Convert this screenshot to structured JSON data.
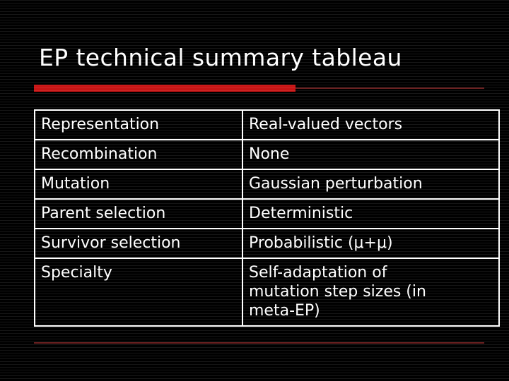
{
  "slide": {
    "title": "EP technical summary tableau",
    "accent_color_thick": "#c81414",
    "accent_color_thin": "#6b2020",
    "text_color": "#ffffff",
    "background_color": "#000000"
  },
  "tableau": {
    "rows": [
      {
        "key": "Representation",
        "value_lines": [
          "Real-valued vectors"
        ]
      },
      {
        "key": "Recombination",
        "value_lines": [
          "None"
        ]
      },
      {
        "key": "Mutation",
        "value_lines": [
          "Gaussian perturbation"
        ]
      },
      {
        "key": "Parent selection",
        "value_lines": [
          "Deterministic"
        ]
      },
      {
        "key": "Survivor selection",
        "value_lines": [
          "Probabilistic (μ+μ)"
        ]
      },
      {
        "key": "Specialty",
        "value_lines": [
          "Self-adaptation of",
          "mutation step sizes (in",
          "meta-EP)"
        ]
      }
    ]
  }
}
